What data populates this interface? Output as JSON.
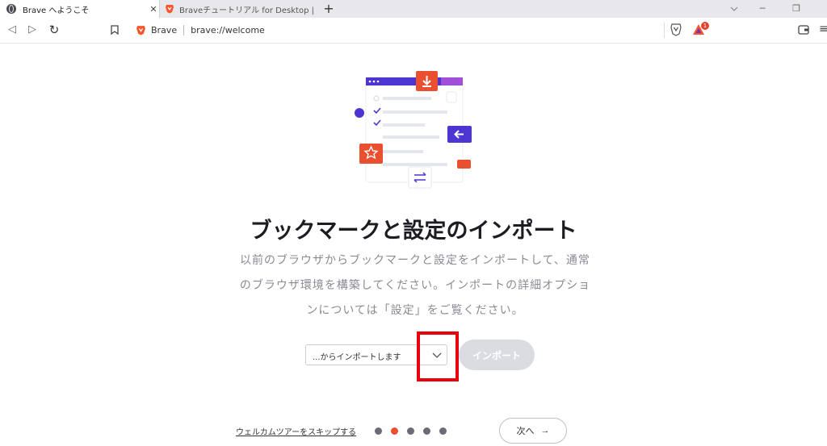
{
  "tabs": [
    {
      "title": "Brave へようこそ",
      "active": true,
      "close": "✕"
    },
    {
      "title": "Braveチュートリアル for Desktop | Brave B",
      "active": false
    }
  ],
  "window": {
    "new_tab": "+",
    "minimize": "─",
    "restore": "❐"
  },
  "toolbar": {
    "back": "◁",
    "forward": "▷",
    "reload": "↻",
    "menu": "≡"
  },
  "omnibox": {
    "brand": "Brave",
    "url": "brave://welcome"
  },
  "rewards": {
    "badge": "1"
  },
  "colors": {
    "brand_orange": "#fb542b",
    "purple": "#4c35d1",
    "highlight_red": "#e8000a"
  },
  "page": {
    "title": "ブックマークと設定のインポート",
    "description_lines": [
      "以前のブラウザからブックマークと設定をインポートして、通常",
      "のブラウザ環境を構築してください。インポートの詳細オプショ",
      "ンについては「設定」をご覧ください。"
    ],
    "select_value": "...からインポートします",
    "import_label": "インポート",
    "skip_label": "ウェルカムツアーをスキップする",
    "next_label": "次へ",
    "next_arrow": "→"
  },
  "steps": {
    "total": 5,
    "current": 2
  }
}
